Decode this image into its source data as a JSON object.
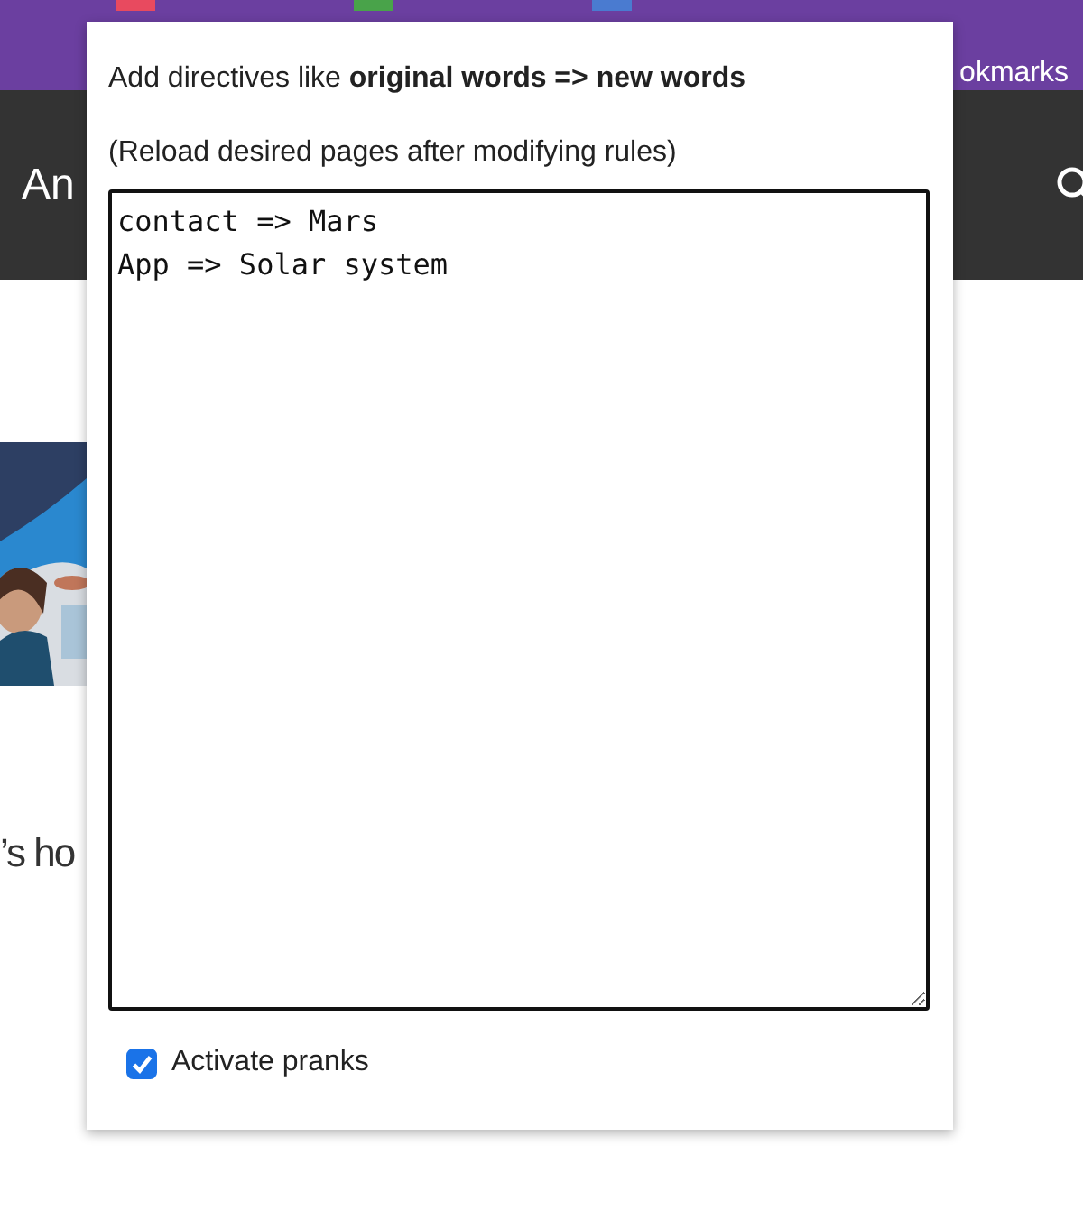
{
  "browser_toolbar": {
    "bookmarks_label": "okmarks"
  },
  "page_header": {
    "title": "An"
  },
  "page_body": {
    "text": "’s ho"
  },
  "popup": {
    "instruction": "Add directives like **original words => new words**",
    "note": "(Reload desired pages after modifying rules)",
    "rules_editor": {
      "lines": [
        "contact => Mars",
        "App => Solar system"
      ]
    },
    "activate_checkbox": {
      "label": "Activate pranks",
      "checked": true
    }
  }
}
